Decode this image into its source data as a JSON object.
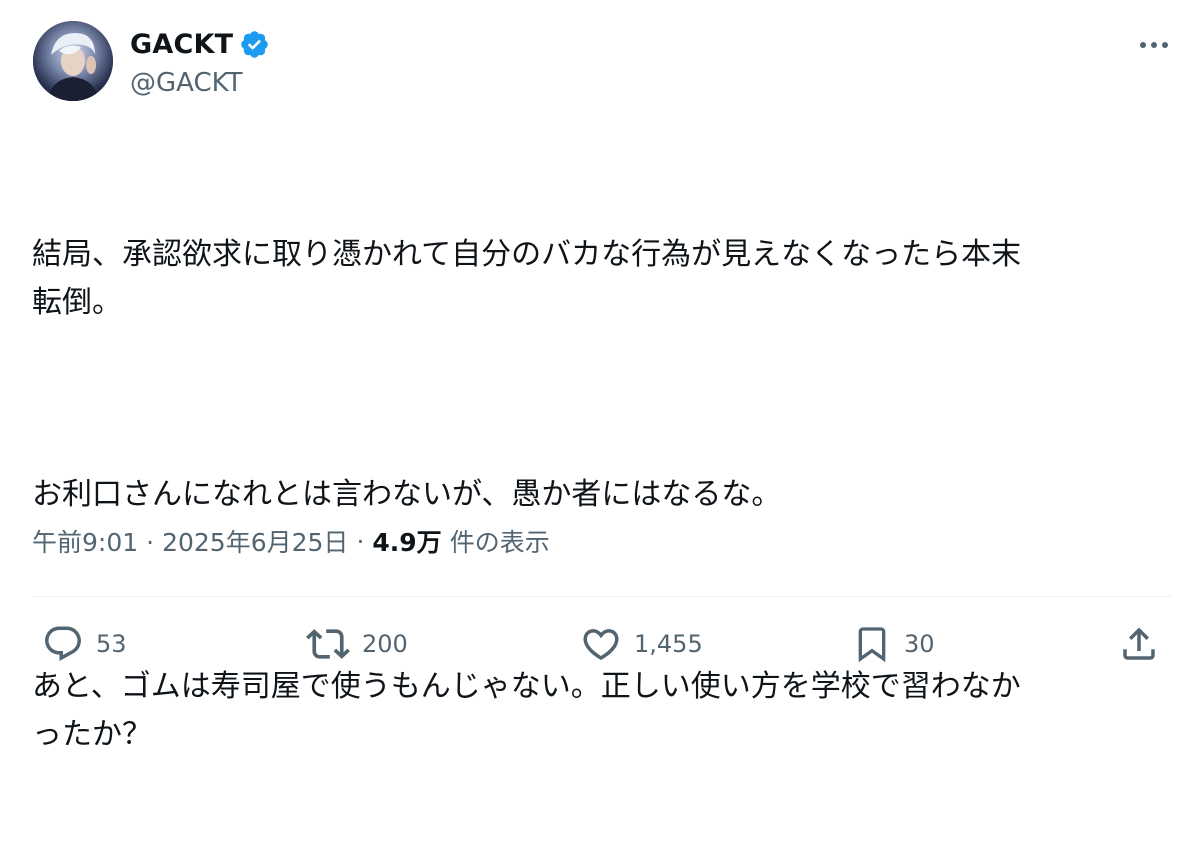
{
  "author": {
    "display_name": "GACKT",
    "handle": "@GACKT",
    "verified": true,
    "verified_color": "#1d9bf0"
  },
  "tweet": {
    "paragraphs": [
      "結局、承認欲求に取り憑かれて自分のバカな行為が見えなくなったら本末\n転倒。",
      "お利口さんになれとは言わないが、愚か者にはなるな。",
      "あと、ゴムは寿司屋で使うもんじゃない。正しい使い方を学校で習わなか\nったか？"
    ]
  },
  "meta": {
    "time": "午前9:01",
    "separator": "·",
    "date": "2025年6月25日",
    "views_count": "4.9万",
    "views_label": "件の表示"
  },
  "actions": {
    "reply": {
      "icon": "reply-icon",
      "count": "53"
    },
    "retweet": {
      "icon": "retweet-icon",
      "count": "200"
    },
    "like": {
      "icon": "heart-icon",
      "count": "1,455"
    },
    "bookmark": {
      "icon": "bookmark-icon",
      "count": "30"
    },
    "share": {
      "icon": "share-icon"
    }
  },
  "icons": {
    "more": "more-horizontal-icon"
  },
  "colors": {
    "text_primary": "#0f1419",
    "text_secondary": "#536471",
    "divider": "#eff3f4",
    "accent": "#1d9bf0"
  }
}
